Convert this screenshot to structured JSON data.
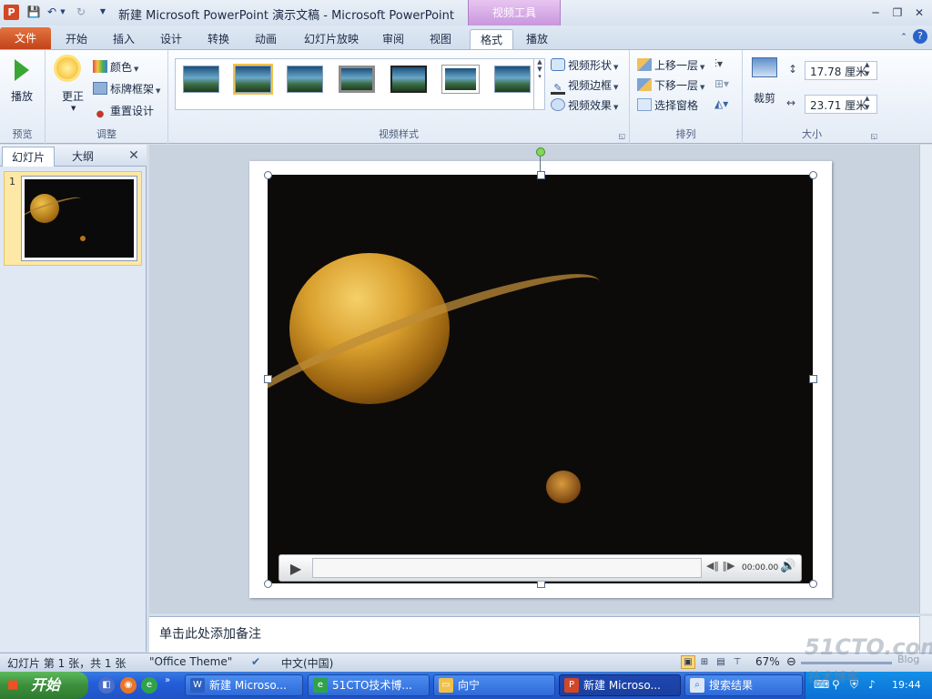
{
  "window": {
    "title": "新建 Microsoft PowerPoint 演示文稿 - Microsoft PowerPoint",
    "context_tab": "视频工具",
    "app_icon": "P"
  },
  "tabs": {
    "file": "文件",
    "items": [
      "开始",
      "插入",
      "设计",
      "转换",
      "动画",
      "幻灯片放映",
      "审阅",
      "视图",
      "格式",
      "播放"
    ],
    "active": "格式"
  },
  "ribbon": {
    "preview": {
      "play": "播放",
      "group": "预览"
    },
    "adjust": {
      "correct": "更正",
      "color": "颜色",
      "poster": "标牌框架",
      "reset": "重置设计",
      "group": "调整"
    },
    "video_styles": {
      "shape": "视频形状",
      "border": "视频边框",
      "effects": "视频效果",
      "group": "视频样式"
    },
    "arrange": {
      "bring_forward": "上移一层",
      "send_backward": "下移一层",
      "selection_pane": "选择窗格",
      "group": "排列"
    },
    "size": {
      "crop": "裁剪",
      "height": "17.78 厘米",
      "width": "23.71 厘米",
      "group": "大小"
    }
  },
  "left_panel": {
    "tab_slides": "幻灯片",
    "tab_outline": "大纲",
    "slide_number": "1"
  },
  "video_controls": {
    "timecode": "00:00.00",
    "progress": 0
  },
  "notes": {
    "placeholder": "单击此处添加备注"
  },
  "status": {
    "slide_info": "幻灯片 第 1 张，共 1 张",
    "theme": "\"Office Theme\"",
    "language": "中文(中国)",
    "zoom": "67%"
  },
  "taskbar": {
    "start": "开始",
    "tasks": [
      "新建 Microso...",
      "51CTO技术博...",
      "向宁",
      "新建 Microso...",
      "搜索结果"
    ],
    "clock": "19:44"
  },
  "watermark": {
    "site": "51CTO.com",
    "sub": "技术博客",
    "blog": "Blog"
  },
  "colors": {
    "file_tab": "#c2431a",
    "context_tab": "#c896dd",
    "taskbar": "#245edb",
    "start": "#3c8f3c"
  }
}
